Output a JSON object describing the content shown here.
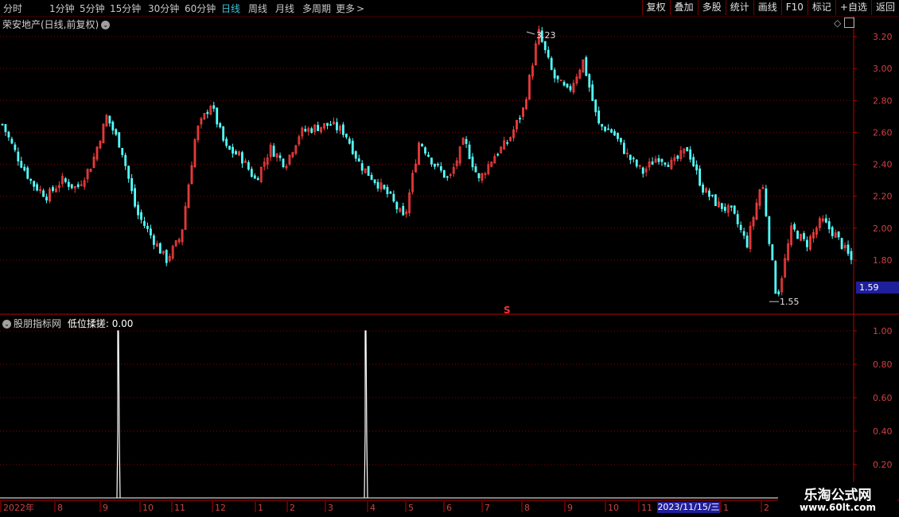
{
  "toolbar": {
    "periods": [
      "分时",
      "1分钟",
      "5分钟",
      "15分钟",
      "30分钟",
      "60分钟",
      "日线",
      "周线",
      "月线",
      "多周期",
      "更多"
    ],
    "active_period": "日线",
    "more_arrow": ">",
    "actions": [
      "复权",
      "叠加",
      "多股",
      "统计",
      "画线",
      "F10",
      "标记",
      "+自选",
      "返回"
    ]
  },
  "main_panel": {
    "title": "荣安地产(日线,前复权)",
    "current_price_tag": "1.59",
    "high_marker": "3.23",
    "low_marker": "1.55",
    "s_marker": "S"
  },
  "indicator_panel": {
    "title": "股朋指标网",
    "indicator_label": "低位揉搓: 0.00"
  },
  "axes": {
    "price_ticks": [
      "3.20",
      "3.00",
      "2.80",
      "2.60",
      "2.40",
      "2.20",
      "2.00",
      "1.80"
    ],
    "indicator_ticks": [
      "1.00",
      "0.80",
      "0.60",
      "0.40",
      "0.20"
    ],
    "date_labels": [
      "2022年",
      "8",
      "9",
      "10",
      "11",
      "12",
      "1",
      "2",
      "3",
      "4",
      "5",
      "6",
      "7",
      "8",
      "9",
      "10",
      "11",
      "2023/11/15/三",
      "1",
      "2"
    ]
  },
  "watermark": {
    "title": "乐淘公式网",
    "url": "www.60lt.com"
  },
  "colors": {
    "up": "#ff4040",
    "down": "#54ffff",
    "grid": "#8b0000",
    "axis": "#c00000",
    "active_tab": "#3ec3d8",
    "tag_bg": "#1f1f9a"
  },
  "chart_data": [
    {
      "type": "candlestick",
      "title": "荣安地产(日线,前复权)",
      "ylim": [
        1.5,
        3.25
      ],
      "y_ticks": [
        1.8,
        2.0,
        2.2,
        2.4,
        2.6,
        2.8,
        3.0,
        3.2
      ],
      "x_range": [
        "2022-07",
        "2024-02"
      ],
      "close_path": [
        [
          "2022-07",
          2.65
        ],
        [
          "2022-07",
          2.45
        ],
        [
          "2022-08",
          2.28
        ],
        [
          "2022-08",
          2.2
        ],
        [
          "2022-08",
          2.3
        ],
        [
          "2022-09",
          2.25
        ],
        [
          "2022-09",
          2.4
        ],
        [
          "2022-09",
          2.7
        ],
        [
          "2022-09",
          2.5
        ],
        [
          "2022-10",
          2.1
        ],
        [
          "2022-10",
          1.95
        ],
        [
          "2022-10",
          1.8
        ],
        [
          "2022-11",
          1.95
        ],
        [
          "2022-11",
          2.6
        ],
        [
          "2022-11",
          2.78
        ],
        [
          "2022-12",
          2.5
        ],
        [
          "2022-12",
          2.45
        ],
        [
          "2023-01",
          2.3
        ],
        [
          "2023-01",
          2.5
        ],
        [
          "2023-02",
          2.4
        ],
        [
          "2023-02",
          2.6
        ],
        [
          "2023-02",
          2.63
        ],
        [
          "2023-03",
          2.65
        ],
        [
          "2023-03",
          2.6
        ],
        [
          "2023-03",
          2.4
        ],
        [
          "2023-04",
          2.3
        ],
        [
          "2023-04",
          2.2
        ],
        [
          "2023-04",
          2.05
        ],
        [
          "2023-05",
          2.55
        ],
        [
          "2023-05",
          2.4
        ],
        [
          "2023-05",
          2.3
        ],
        [
          "2023-06",
          2.55
        ],
        [
          "2023-06",
          2.3
        ],
        [
          "2023-06",
          2.45
        ],
        [
          "2023-07",
          2.55
        ],
        [
          "2023-07",
          2.75
        ],
        [
          "2023-08",
          3.23
        ],
        [
          "2023-08",
          2.95
        ],
        [
          "2023-08",
          2.85
        ],
        [
          "2023-08",
          3.05
        ],
        [
          "2023-09",
          2.65
        ],
        [
          "2023-09",
          2.6
        ],
        [
          "2023-09",
          2.45
        ],
        [
          "2023-10",
          2.35
        ],
        [
          "2023-10",
          2.45
        ],
        [
          "2023-10",
          2.4
        ],
        [
          "2023-11",
          2.5
        ],
        [
          "2023-11",
          2.25
        ],
        [
          "2023-11",
          2.15
        ],
        [
          "2023-12",
          2.1
        ],
        [
          "2023-12",
          1.9
        ],
        [
          "2023-12",
          2.3
        ],
        [
          "2023-12",
          1.55
        ],
        [
          "2024-01",
          2.0
        ],
        [
          "2024-01",
          1.9
        ],
        [
          "2024-01",
          2.05
        ],
        [
          "2024-02",
          1.95
        ],
        [
          "2024-02",
          1.8
        ]
      ],
      "annotations": [
        {
          "label": "3.23",
          "type": "high"
        },
        {
          "label": "1.55",
          "type": "low"
        }
      ]
    },
    {
      "type": "line",
      "title": "低位揉搓",
      "ylim": [
        0,
        1.1
      ],
      "y_ticks": [
        0.2,
        0.4,
        0.6,
        0.8,
        1.0
      ],
      "spikes": [
        {
          "date": "2022-09",
          "value": 1.0
        },
        {
          "date": "2023-03",
          "value": 1.0
        }
      ],
      "current_value": 0.0
    }
  ]
}
